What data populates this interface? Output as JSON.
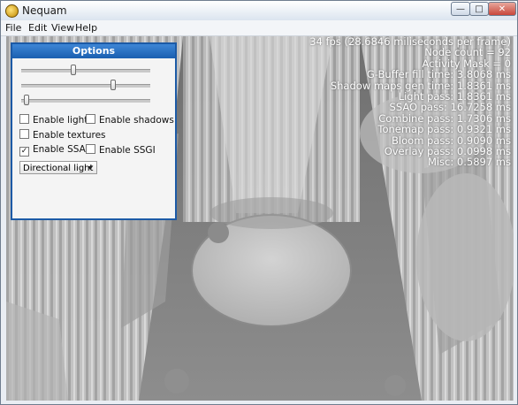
{
  "window": {
    "title": "Nequam",
    "min_glyph": "—",
    "max_glyph": "□",
    "close_glyph": "✕"
  },
  "menu": [
    "File",
    "Edit",
    "View",
    "Help"
  ],
  "stats": [
    "34 fps (28.6846 miliseconds per frame)",
    "Node count = 92",
    "Activity Mask = 0",
    "G-Buffer fill time: 3.8068 ms",
    "Shadow maps gen time: 1.8361 ms",
    "Light pass: 1.8361 ms",
    "SSAO pass: 16.7258 ms",
    "Combine pass: 1.7306 ms",
    "Tonemap pass: 0.9321 ms",
    "Bloom pass: 0.9090 ms",
    "Overlay pass: 0.0998 ms",
    "Misc: 0.5897 ms"
  ],
  "options": {
    "title": "Options",
    "sliders": [
      0.4,
      0.72,
      0.02
    ],
    "checkboxes": [
      {
        "label": "Enable lights",
        "checked": false
      },
      {
        "label": "Enable shadows",
        "checked": false
      },
      {
        "label": "Enable textures",
        "checked": false
      },
      {
        "label": "Enable SSAO",
        "checked": true
      },
      {
        "label": "Enable SSGI",
        "checked": false
      }
    ],
    "light_type": "Directional light"
  }
}
